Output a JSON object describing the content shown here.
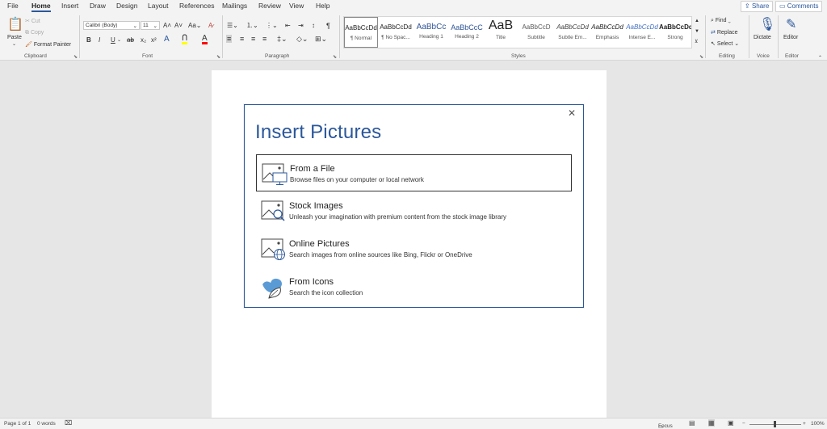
{
  "tabs": [
    "File",
    "Home",
    "Insert",
    "Draw",
    "Design",
    "Layout",
    "References",
    "Mailings",
    "Review",
    "View",
    "Help"
  ],
  "active_tab": "Home",
  "share_label": "Share",
  "comments_label": "Comments",
  "clipboard": {
    "paste": "Paste",
    "cut": "Cut",
    "copy": "Copy",
    "format_painter": "Format Painter",
    "label": "Clipboard"
  },
  "font": {
    "name": "Calibri (Body)",
    "size": "11",
    "label": "Font"
  },
  "paragraph": {
    "label": "Paragraph"
  },
  "styles": {
    "label": "Styles",
    "items": [
      {
        "preview": "AaBbCcDd",
        "name": "¶ Normal"
      },
      {
        "preview": "AaBbCcDd",
        "name": "¶ No Spac..."
      },
      {
        "preview": "AaBbCc",
        "name": "Heading 1"
      },
      {
        "preview": "AaBbCcC",
        "name": "Heading 2"
      },
      {
        "preview": "AaB",
        "name": "Title"
      },
      {
        "preview": "AaBbCcD",
        "name": "Subtitle"
      },
      {
        "preview": "AaBbCcDd",
        "name": "Subtle Em..."
      },
      {
        "preview": "AaBbCcDd",
        "name": "Emphasis"
      },
      {
        "preview": "AaBbCcDd",
        "name": "Intense E..."
      },
      {
        "preview": "AaBbCcDd",
        "name": "Strong"
      }
    ]
  },
  "editing": {
    "find": "Find",
    "replace": "Replace",
    "select": "Select",
    "label": "Editing"
  },
  "voice": {
    "dictate": "Dictate",
    "label": "Voice"
  },
  "editor": {
    "editor": "Editor",
    "label": "Editor"
  },
  "dialog": {
    "title": "Insert Pictures",
    "options": [
      {
        "title": "From a File",
        "desc": "Browse files on your computer or local network"
      },
      {
        "title": "Stock Images",
        "desc": "Unleash your imagination with premium content from the stock image library"
      },
      {
        "title": "Online Pictures",
        "desc": "Search images from online sources like Bing, Flickr or OneDrive"
      },
      {
        "title": "From Icons",
        "desc": "Search the icon collection"
      }
    ]
  },
  "status": {
    "page": "Page 1 of 1",
    "words": "0 words",
    "focus": "Focus",
    "zoom": "100%"
  },
  "colors": {
    "accent": "#2b579a",
    "highlight": "#ffff00",
    "font_color": "#ff0000"
  }
}
